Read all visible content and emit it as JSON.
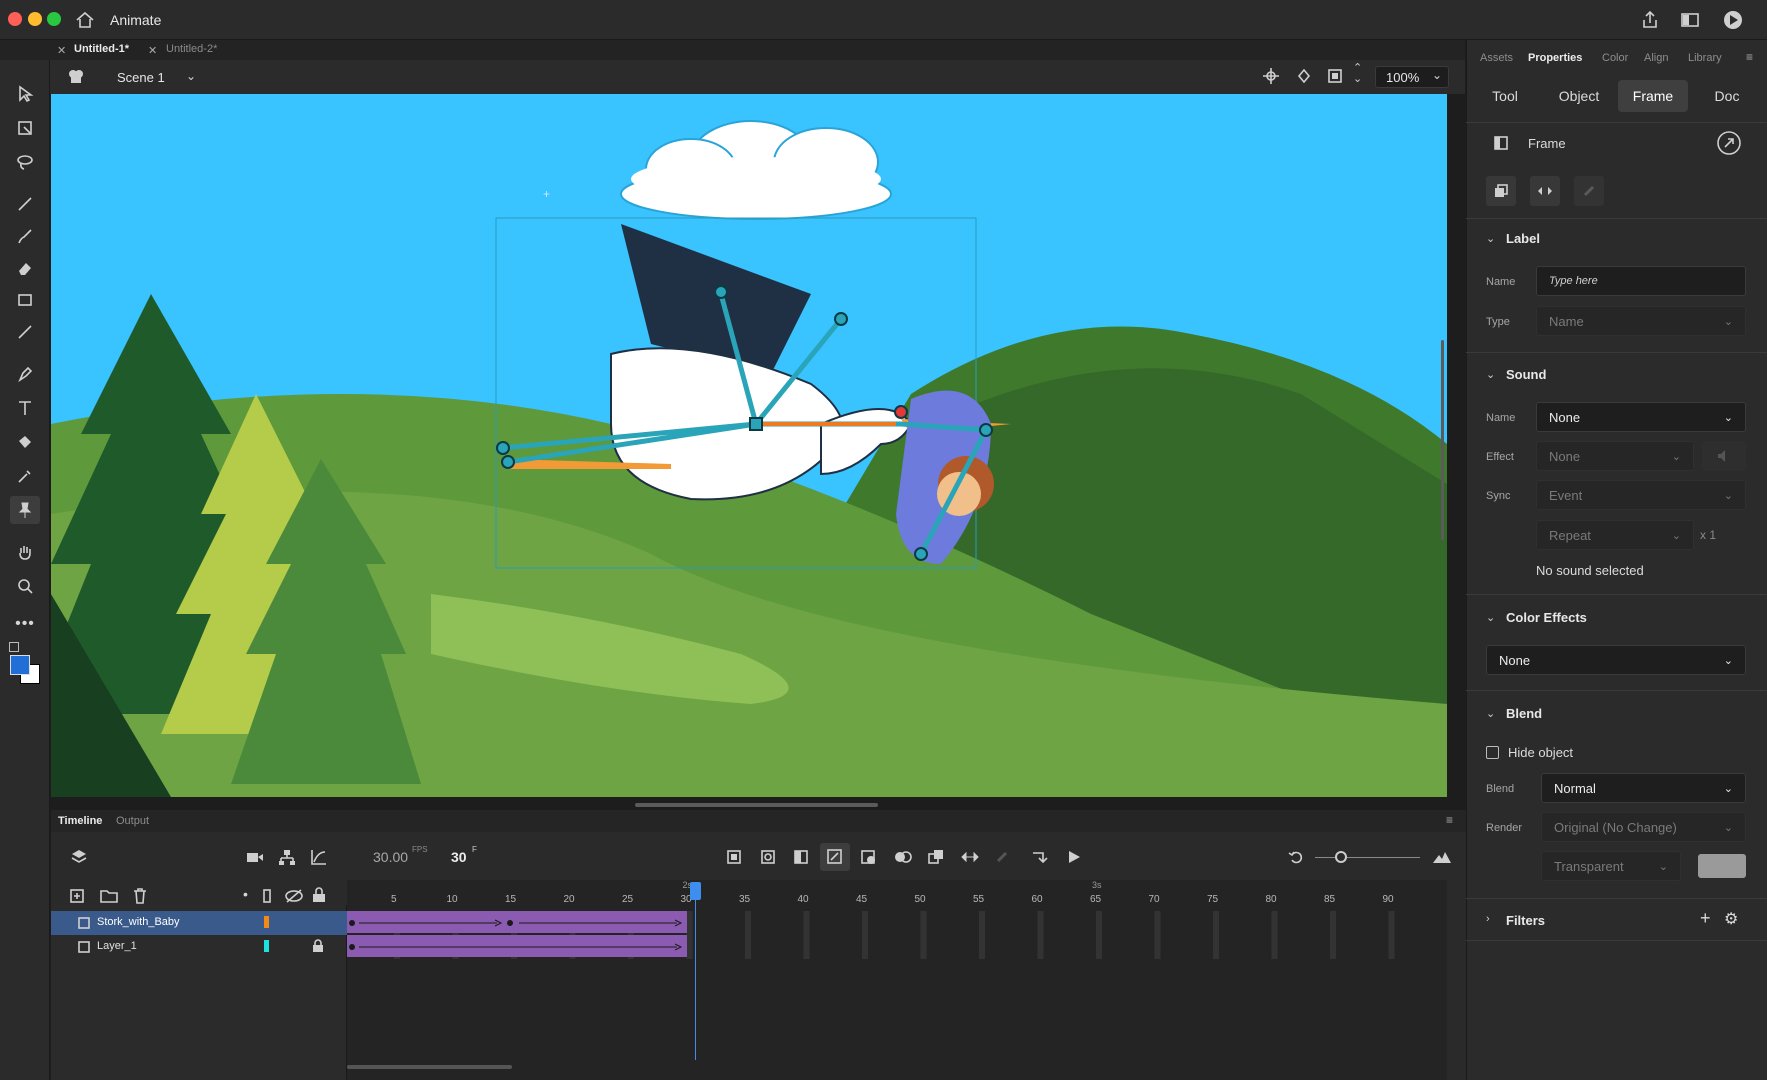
{
  "app": {
    "title": "Animate"
  },
  "documents": {
    "tabs": [
      {
        "label": "Untitled-1*",
        "active": true
      },
      {
        "label": "Untitled-2*",
        "active": false
      }
    ]
  },
  "editbar": {
    "scene": "Scene 1",
    "zoom": "100%"
  },
  "right_panel": {
    "tabs": [
      "Assets",
      "Properties",
      "Color",
      "Align",
      "Library"
    ],
    "active_tab": "Properties",
    "subtabs": [
      "Tool",
      "Object",
      "Frame",
      "Doc"
    ],
    "active_subtab": "Frame",
    "frame_header": "Frame",
    "label_section": {
      "title": "Label",
      "name_label": "Name",
      "name_placeholder": "Type here",
      "type_label": "Type",
      "type_value": "Name"
    },
    "sound_section": {
      "title": "Sound",
      "name_label": "Name",
      "name_value": "None",
      "effect_label": "Effect",
      "effect_value": "None",
      "sync_label": "Sync",
      "sync_value": "Event",
      "repeat_value": "Repeat",
      "repeat_count": "x 1",
      "status": "No sound selected"
    },
    "color_effects": {
      "title": "Color Effects",
      "value": "None"
    },
    "blend_section": {
      "title": "Blend",
      "hide_object": "Hide object",
      "hide_object_checked": false,
      "blend_label": "Blend",
      "blend_value": "Normal",
      "render_label": "Render",
      "render_value": "Original (No Change)",
      "bg_value": "Transparent"
    },
    "filters": {
      "title": "Filters"
    }
  },
  "timeline": {
    "tabs": [
      "Timeline",
      "Output"
    ],
    "fps": "30.00",
    "fps_unit": "FPS",
    "current_frame": "30",
    "frame_unit": "F",
    "frame_numbers": [
      "5",
      "10",
      "15",
      "20",
      "25",
      "30",
      "35",
      "40",
      "45",
      "50",
      "55",
      "60",
      "65",
      "70",
      "75",
      "80",
      "85",
      "90"
    ],
    "seconds_labels": [
      "2s",
      "3s"
    ],
    "layers": [
      {
        "name": "Stork_with_Baby",
        "color": "#f28a1a",
        "selected": true,
        "locked": false
      },
      {
        "name": "Layer_1",
        "color": "#1ee1e1",
        "selected": false,
        "locked": true
      }
    ]
  },
  "colors": {
    "accent": "#3e8ef0",
    "tween": "#8a5bb0",
    "sky": "#39c3ff",
    "selected_layer": "#3a5a8c"
  }
}
